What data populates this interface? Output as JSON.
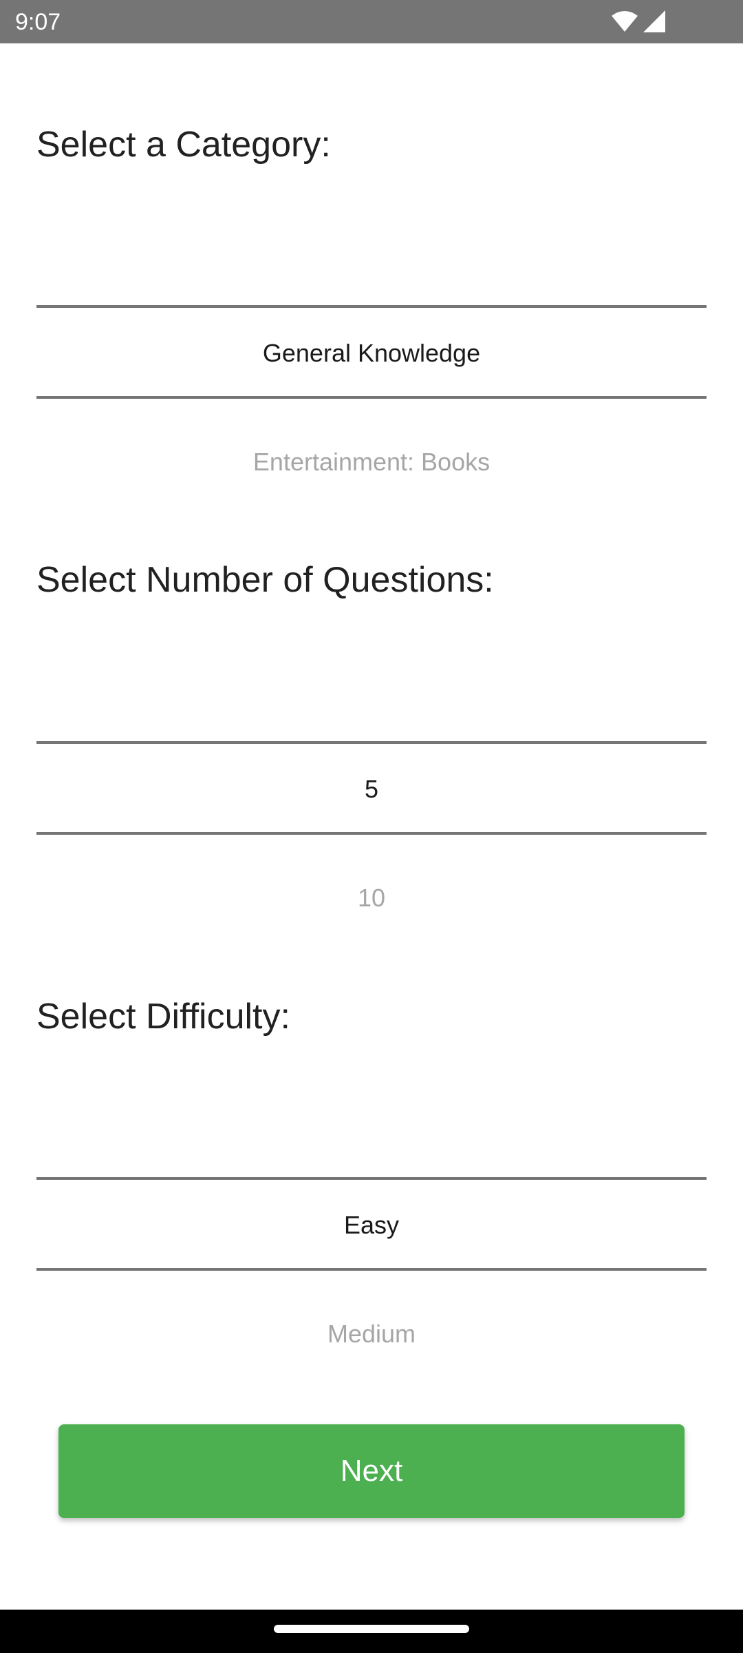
{
  "status_bar": {
    "time": "9:07",
    "icons": [
      "wifi-icon",
      "signal-icon"
    ]
  },
  "category": {
    "title": "Select a Category:",
    "selected": "General Knowledge",
    "next_option": "Entertainment: Books"
  },
  "questions": {
    "title": "Select Number of Questions:",
    "selected": "5",
    "next_option": "10"
  },
  "difficulty": {
    "title": "Select Difficulty:",
    "selected": "Easy",
    "next_option": "Medium"
  },
  "next_button": {
    "label": "Next"
  },
  "colors": {
    "accent": "#4caf50",
    "status_bar": "#757575",
    "nav_bar": "#000000"
  }
}
